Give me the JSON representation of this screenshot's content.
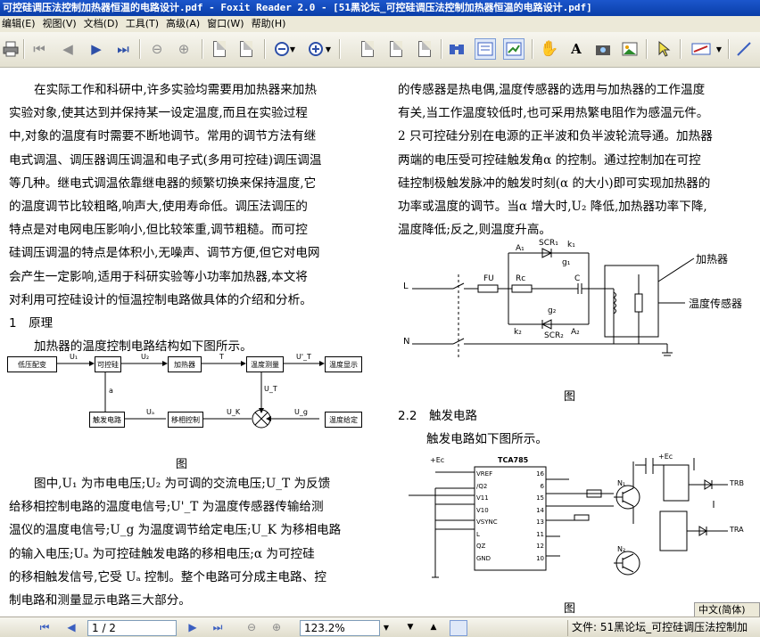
{
  "window": {
    "title": "可控硅调压法控制加热器恒温的电路设计.pdf - Foxit Reader 2.0 - [51黑论坛_可控硅调压法控制加热器恒温的电路设计.pdf]"
  },
  "menu": [
    "编辑(E)",
    "视图(V)",
    "文档(D)",
    "工具(T)",
    "高级(A)",
    "窗口(W)",
    "帮助(H)"
  ],
  "toolbar": {
    "icons": [
      "print-icon",
      "first-page-icon",
      "prev-page-icon",
      "next-page-icon",
      "last-page-icon",
      "back-icon",
      "forward-icon",
      "copy-icon",
      "paste-icon",
      "zoom-out-icon",
      "zoom-in-icon",
      "single-page-icon",
      "continuous-icon",
      "facing-icon",
      "find-icon",
      "bookmark-icon",
      "thumbnail-icon",
      "hand-tool-icon",
      "text-select-icon",
      "snapshot-icon",
      "image-icon",
      "arrow-tool-icon",
      "highlight-icon"
    ]
  },
  "left_column": {
    "p1": [
      "在实际工作和科研中,许多实验均需要用加热器来加热",
      "实验对象,使其达到并保持某一设定温度,而且在实验过程",
      "中,对象的温度有时需要不断地调节。常用的调节方法有继",
      "电式调温、调压器调压调温和电子式(多用可控硅)调压调温",
      "等几种。继电式调温依靠继电器的频繁切换来保持温度,它",
      "的温度调节比较粗略,响声大,使用寿命低。调压法调压的",
      "特点是对电网电压影响小,但比较笨重,调节粗糙。而可控",
      "硅调压调温的特点是体积小,无噪声、调节方便,但它对电网",
      "会产生一定影响,适用于科研实验等小功率加热器,本文将",
      "对利用可控硅设计的恒温控制电路做具体的介绍和分析。"
    ],
    "section1": "1　原理",
    "s1_intro": "加热器的温度控制电路结构如下图所示。",
    "block_diagram": {
      "b1": "低压配变",
      "b2": "可控硅",
      "b3": "加热器",
      "b4": "温度测量",
      "b5": "温度显示",
      "b6": "触发电路",
      "b7": "移相控制",
      "b8": "温度给定",
      "u1": "U₁",
      "u2": "U₂",
      "t": "T",
      "ut": "U_T",
      "ut2": "U'_T",
      "a": "a",
      "ua": "Uₐ",
      "uk": "U_K",
      "ug": "U_g"
    },
    "fig1_caption": "图",
    "p2": [
      "图中,U₁ 为市电电压;U₂ 为可调的交流电压;U_T 为反馈",
      "给移相控制电路的温度电信号;U'_T 为温度传感器传输给测",
      "温仪的温度电信号;U_g 为温度调节给定电压;U_K 为移相电路",
      "的输入电压;Uₐ 为可控硅触发电路的移相电压;α 为可控硅",
      "的移相触发信号,它受 Uₐ 控制。整个电路可分成主电路、控",
      "制电路和测量显示电路三大部分。"
    ]
  },
  "right_column": {
    "p1": [
      "的传感器是热电偶,温度传感器的选用与加热器的工作温度",
      "有关,当工作温度较低时,也可采用热繁电阻作为感温元件。",
      "2 只可控硅分别在电源的正半波和负半波轮流导通。加热器",
      "两端的电压受可控硅触发角α 的控制。通过控制加在可控",
      "硅控制极触发脉冲的触发时刻(α 的大小)即可实现加热器的",
      "功率或温度的调节。当α 增大时,U₂ 降低,加热器功率下降,",
      "温度降低;反之,则温度升高。"
    ],
    "circuit": {
      "scr1": "SCR₁",
      "scr2": "SCR₂",
      "a1": "A₁",
      "a2": "A₂",
      "k1": "k₁",
      "k2": "k₂",
      "g1": "g₁",
      "g2": "g₂",
      "fu": "FU",
      "rc": "Rc",
      "c": "C",
      "l": "L",
      "n": "N",
      "heater": "加热器",
      "sensor": "温度传感器"
    },
    "fig2_caption": "图",
    "section22": "2.2　触发电路",
    "s22_intro": "触发电路如下图所示。",
    "trigger": {
      "chip": "TCA785",
      "pins_left": [
        "VREF",
        "/Q2",
        "V11",
        "V10",
        "VSYNC",
        "L",
        "QZ",
        "GND"
      ],
      "pins_num_right": [
        "16",
        "6",
        "15",
        "14",
        "13",
        "11",
        "12",
        "10"
      ],
      "ec": "+Ec",
      "trb": "TRB",
      "tra": "TRA",
      "n1": "N₁",
      "n2": "N₂"
    },
    "fig3_caption": "图"
  },
  "ime": "中文(简体)",
  "status": {
    "page_value": "1 / 2",
    "zoom_value": "123.2%",
    "file_label": "文件: 51黑论坛_可控硅调压法控制加"
  }
}
